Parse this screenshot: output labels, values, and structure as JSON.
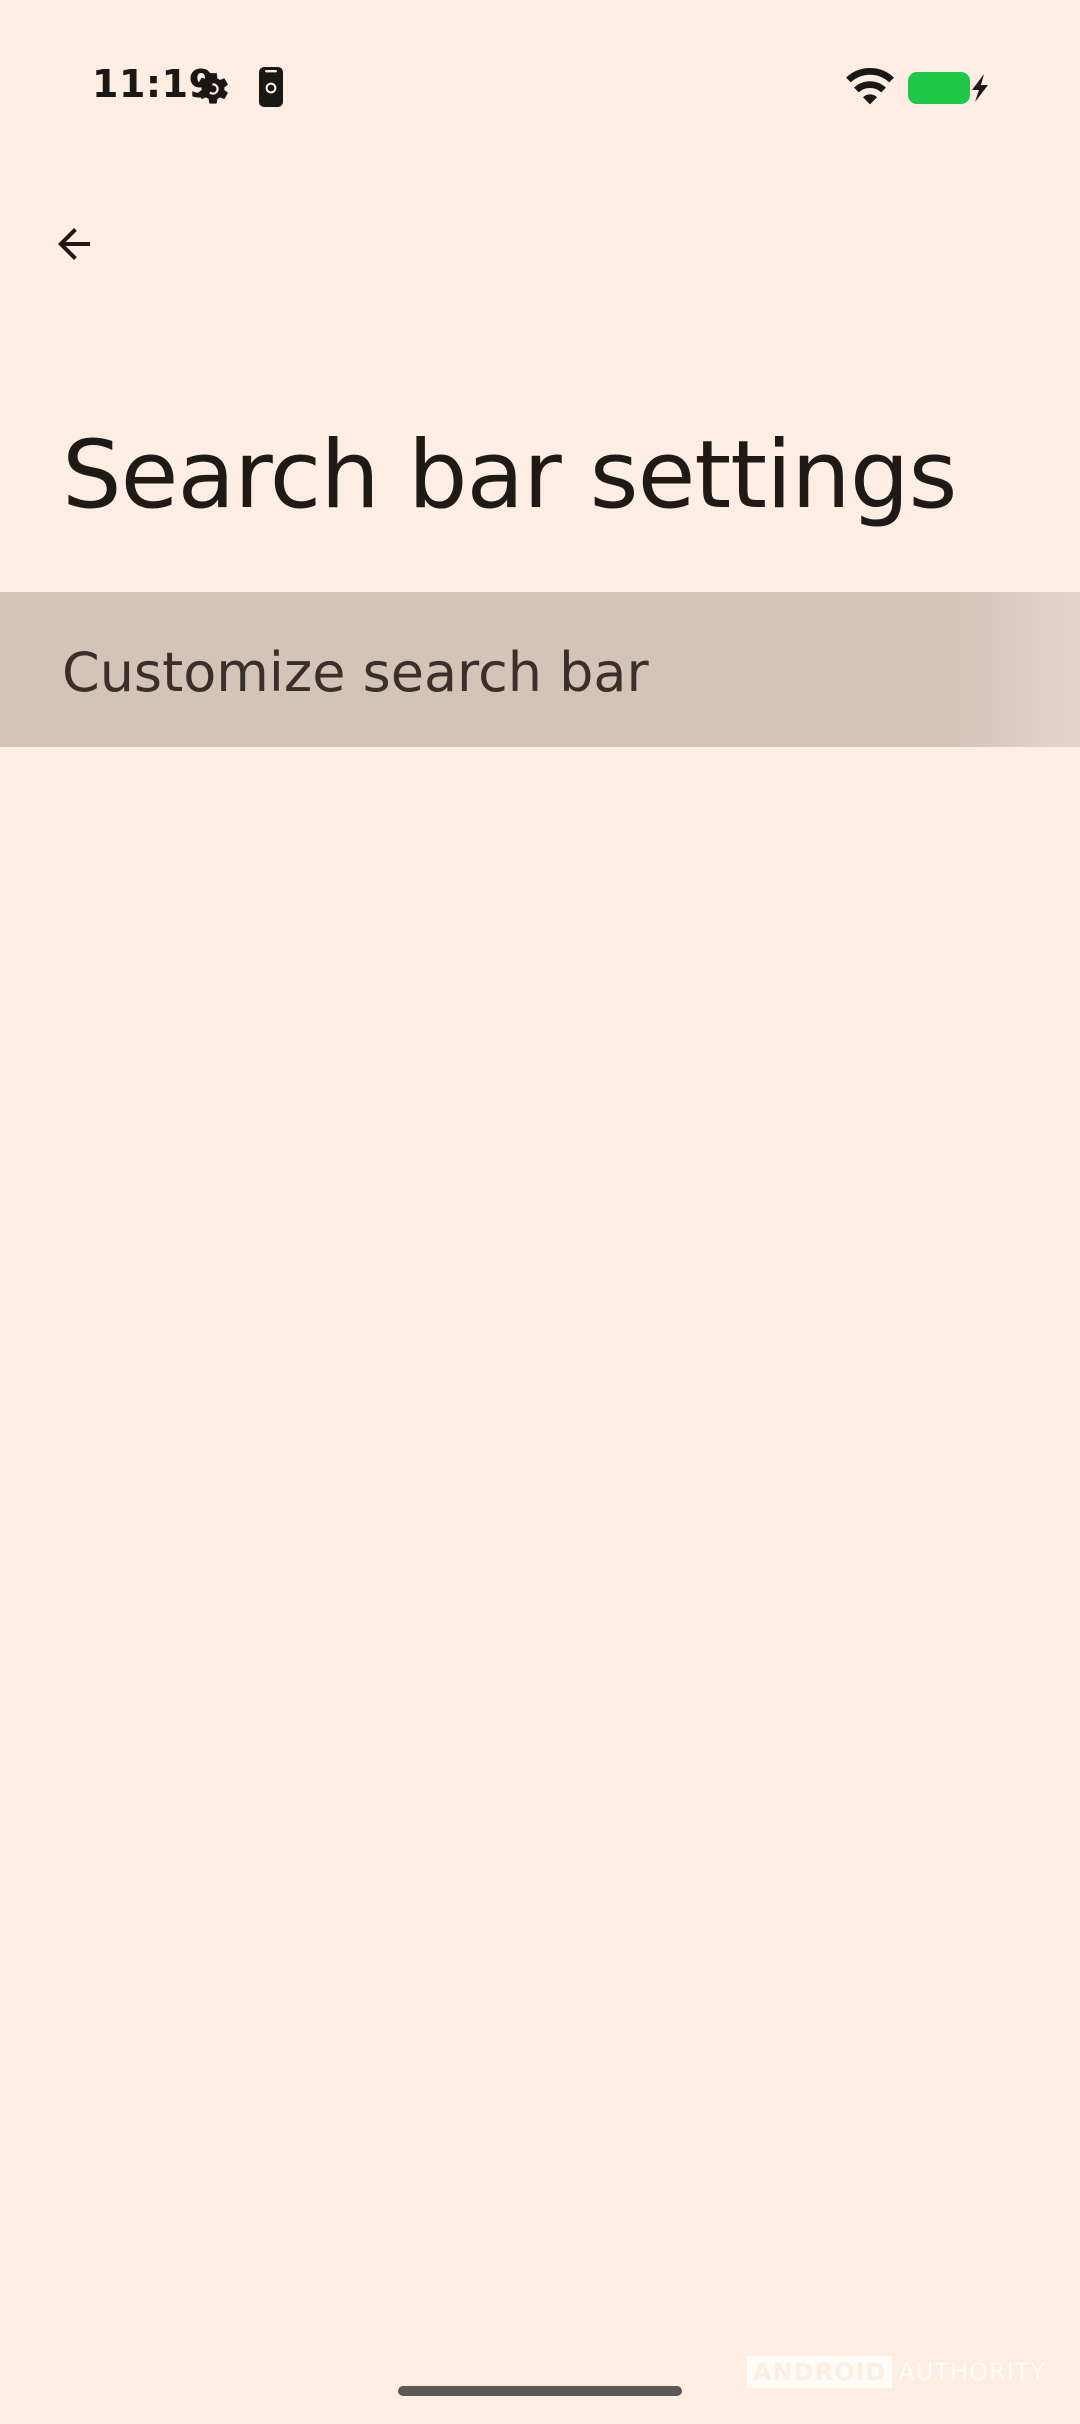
{
  "status_bar": {
    "time": "11:19",
    "icons": [
      "settings-gear-icon",
      "phone-device-icon",
      "wifi-icon",
      "battery-charging-icon"
    ],
    "battery_color": "#1ec94a"
  },
  "header": {
    "back_icon": "arrow-back-icon",
    "title": "Search bar settings"
  },
  "settings": {
    "items": [
      {
        "label": "Customize search bar"
      }
    ]
  },
  "watermark": {
    "brand_boxed": "ANDROID",
    "brand_plain": "AUTHORITY"
  },
  "theme": {
    "background": "#fdede3",
    "item_highlight": "#d3c4b8",
    "text_primary": "#201a17"
  }
}
